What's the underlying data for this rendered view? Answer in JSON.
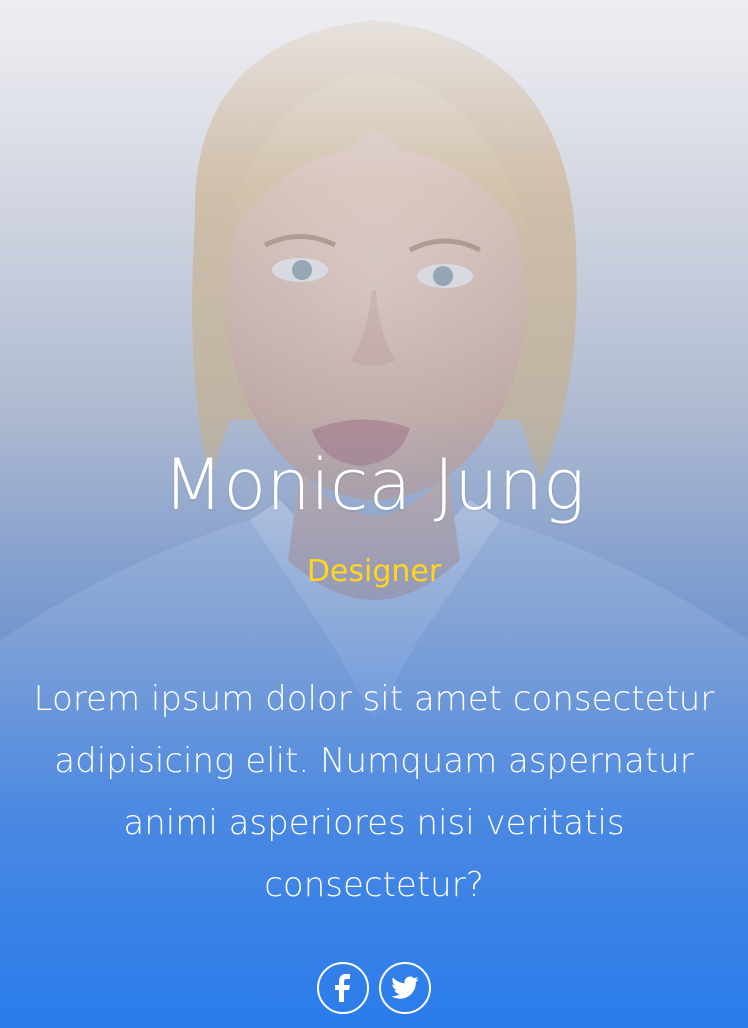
{
  "profile": {
    "name": "Monica Jung",
    "role": "Designer",
    "bio": "Lorem ipsum dolor sit amet consectetur adipisicing elit. Numquam aspernatur animi asperiores nisi veritatis consectetur?"
  },
  "social": {
    "links": [
      {
        "icon": "facebook-icon"
      },
      {
        "icon": "twitter-icon"
      }
    ]
  },
  "colors": {
    "role": "#ffd51e",
    "text": "#ffffff",
    "gradient_bottom": "#2378eb"
  }
}
